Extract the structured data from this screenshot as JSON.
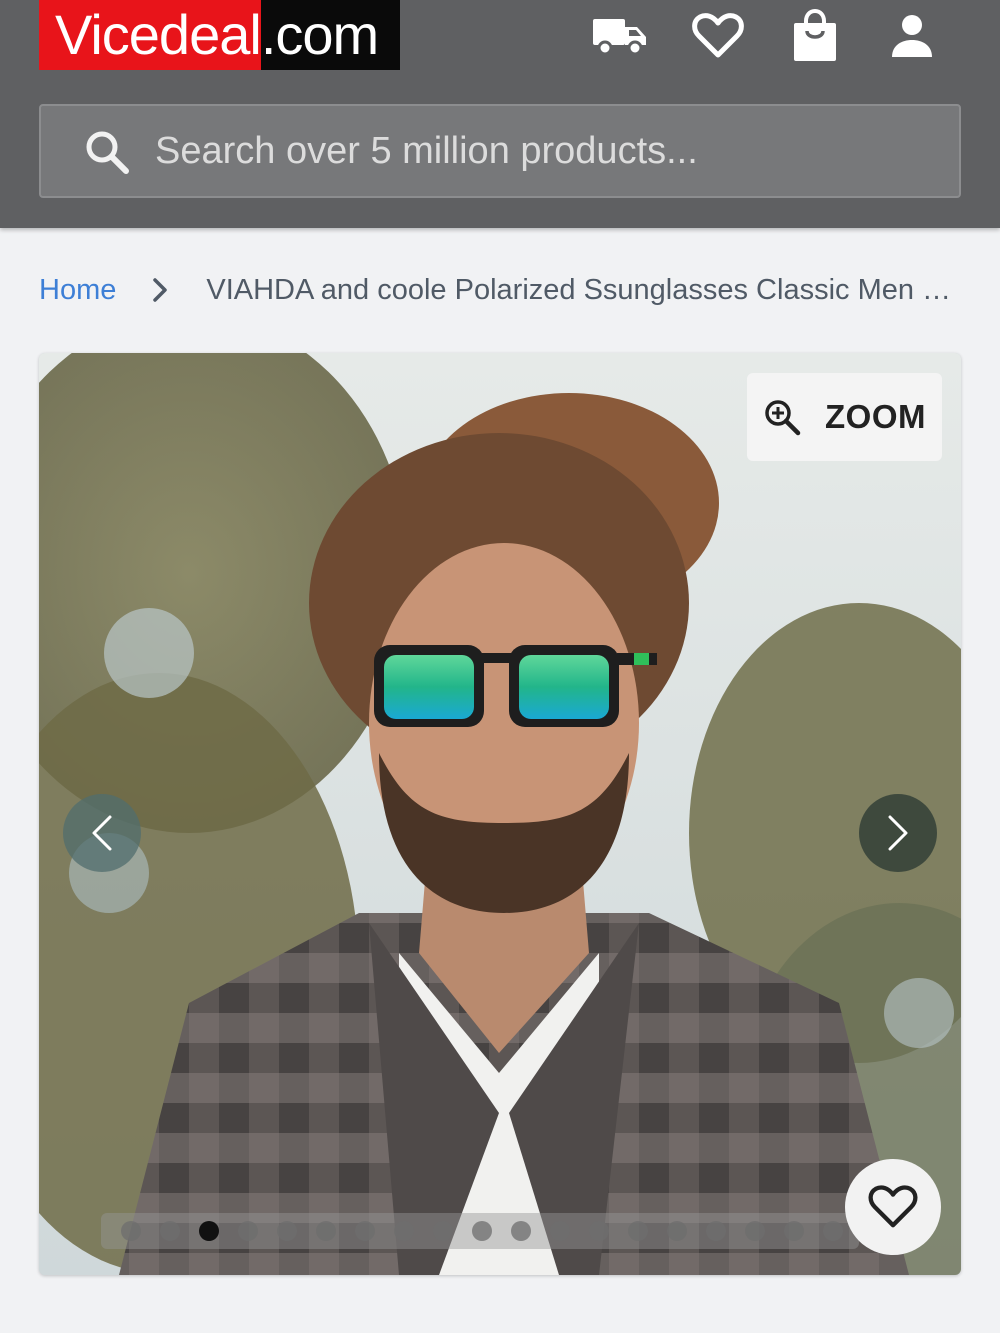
{
  "header": {
    "logo_left": "Vicedeal",
    "logo_right": ".com",
    "icons": [
      "truck-icon",
      "heart-icon",
      "shopping-bag-icon",
      "user-icon"
    ]
  },
  "search": {
    "placeholder": "Search over 5 million products..."
  },
  "breadcrumb": {
    "home": "Home",
    "current": "VIAHDA and coole Polarized Ssunglasses Classic Men Square Sunglasses"
  },
  "gallery": {
    "zoom_label": "ZOOM",
    "image_count": 19,
    "active_index": 2,
    "image_alt": "Man with dreadlocks wearing green mirrored sunglasses"
  },
  "colors": {
    "header_bg": "#5f6062",
    "logo_red": "#e8141a",
    "link_blue": "#3d7fd6"
  }
}
